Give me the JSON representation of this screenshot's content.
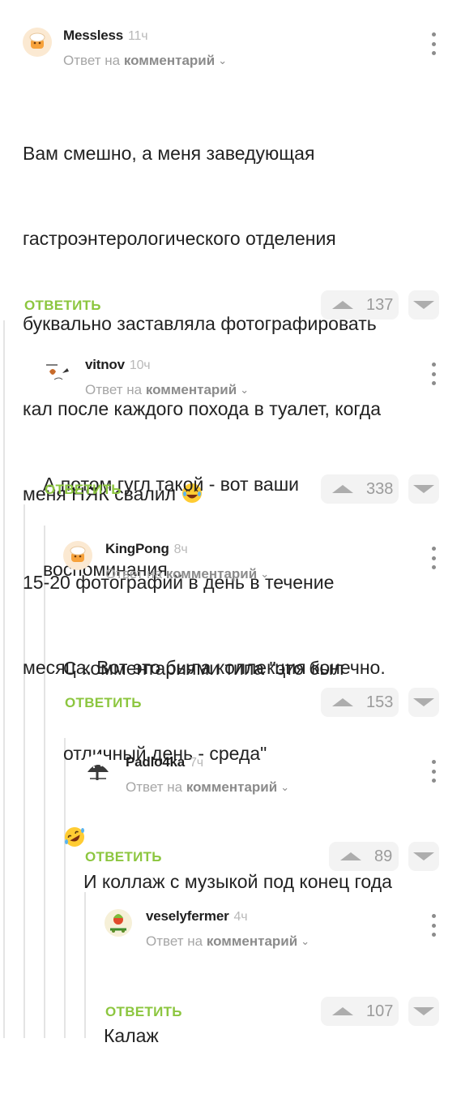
{
  "reply_prefix": "Ответ на",
  "reply_target": "комментарий",
  "reply_action": "ОТВЕТИТЬ",
  "comments": [
    {
      "author": "Messless",
      "time": "11ч",
      "avatar_icon": "cook-avatar-icon",
      "text_lines": [
        "Вам смешно, а меня заведующая",
        "гастроэнтерологического отделения",
        "буквально заставляла фотографировать",
        "кал после каждого похода в туалет, когда",
        "меня НЯК свалил",
        "15-20 фотографий в день в течение",
        "месяца. Вот это была коллекция конечно."
      ],
      "emoji_after_line": 4,
      "emoji": "laughing-emoji",
      "rating": "137"
    },
    {
      "author": "vitnov",
      "time": "10ч",
      "avatar_icon": "sketch-avatar-icon",
      "text_lines": [
        "А потом гугл такой - вот ваши",
        "воспоминания"
      ],
      "rating": "338"
    },
    {
      "author": "KingPong",
      "time": "8ч",
      "avatar_icon": "cook-avatar-icon",
      "text_lines": [
        "С комментариями типа \"это был",
        "отличный день - среда\""
      ],
      "emoji_line": "rofl-emoji",
      "rating": "153"
    },
    {
      "author": "Padlo4ka",
      "time": "7ч",
      "avatar_icon": "tree-avatar-icon",
      "text_lines": [
        "И коллаж с музыкой под конец года"
      ],
      "rating": "89"
    },
    {
      "author": "veselyfermer",
      "time": "4ч",
      "avatar_icon": "farmer-avatar-icon",
      "text_lines": [
        "Калаж"
      ],
      "rating": "107"
    }
  ],
  "colors": {
    "accent_green": "#8cc63f",
    "muted_text": "#a6a6a6",
    "vote_bg": "#f3f3f3"
  }
}
